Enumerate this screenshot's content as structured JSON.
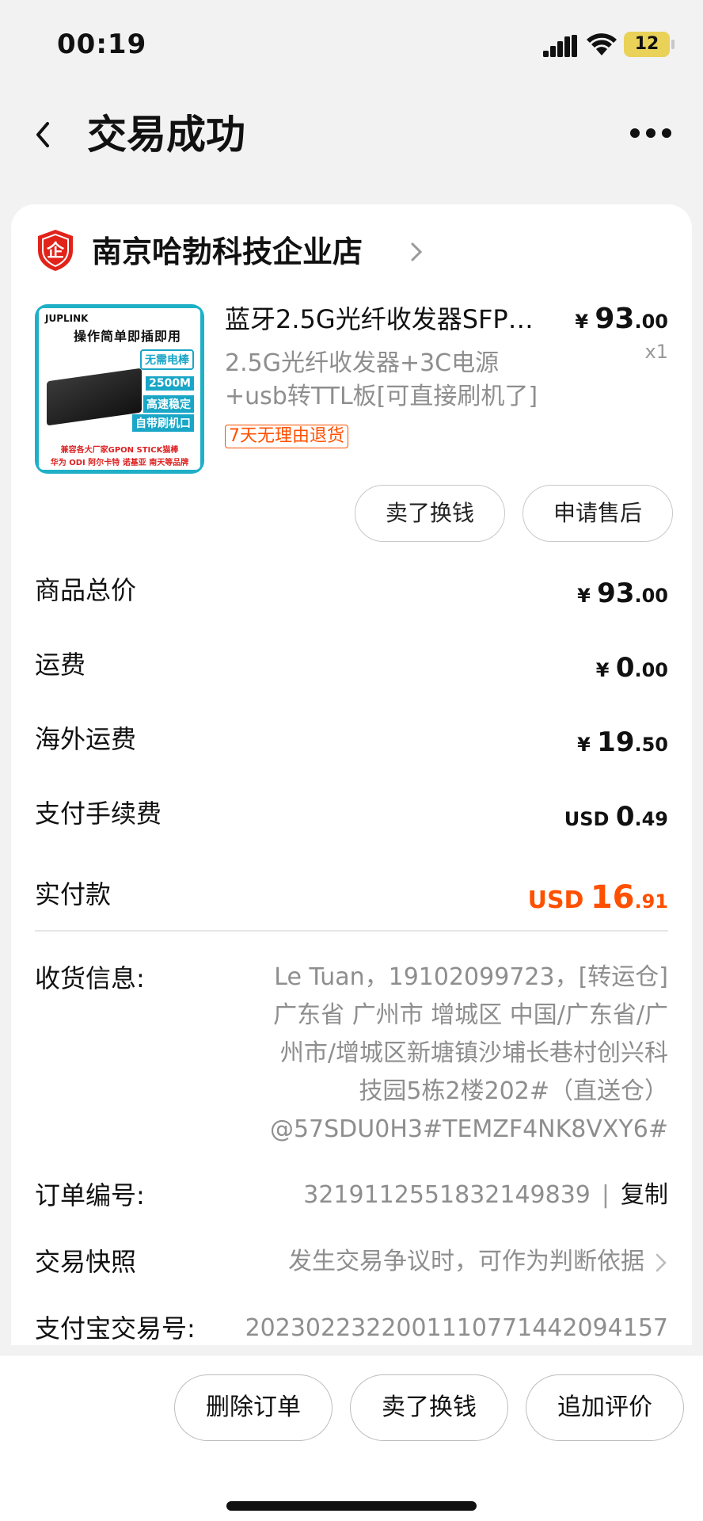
{
  "status_bar": {
    "time": "00:19",
    "battery": "12"
  },
  "nav": {
    "title": "交易成功"
  },
  "shop": {
    "name": "南京哈勃科技企业店"
  },
  "product": {
    "title": "蓝牙2.5G光纤收发器SFP…",
    "price_symbol": "¥",
    "price_int": "93",
    "price_dec": ".00",
    "quantity": "x1",
    "spec_line1": "2.5G光纤收发器+3C电源",
    "spec_line2": "+usb转TTL板[可直接刷机了]",
    "return_badge": "7天无理由退货",
    "image_text": {
      "brand": "JUPLINK",
      "headline": "操作简单即插即用",
      "tag1": "无需电棒",
      "tag2": "2500M",
      "tag3": "高速稳定",
      "tag4": "自带刷机口",
      "footer1": "兼容各大厂家GPON STICK猫棒",
      "footer2": "华为 ODI 阿尔卡特 诺基亚 南天等品牌"
    }
  },
  "actions": {
    "sell_label": "卖了换钱",
    "after_sale_label": "申请售后"
  },
  "fees": {
    "goods_total": {
      "label": "商品总价",
      "cur": "¥",
      "int": "93",
      "dec": ".00"
    },
    "shipping": {
      "label": "运费",
      "cur": "¥",
      "int": "0",
      "dec": ".00"
    },
    "overseas_shipping": {
      "label": "海外运费",
      "cur": "¥",
      "int": "19",
      "dec": ".50"
    },
    "payment_fee": {
      "label": "支付手续费",
      "cur": "USD",
      "int": "0",
      "dec": ".49"
    },
    "paid": {
      "label": "实付款",
      "cur": "USD",
      "int": "16",
      "dec": ".91"
    }
  },
  "address": {
    "label": "收货信息:",
    "lines": [
      "Le Tuan，19102099723，[转运仓]",
      "广东省 广州市 增城区 中国/广东省/广",
      "州市/增城区新塘镇沙埔长巷村创兴科",
      "技园5栋2楼202#（直送仓）",
      "@57SDU0H3#TEMZF4NK8VXY6#"
    ]
  },
  "order": {
    "label": "订单编号:",
    "number": "3219112551832149839",
    "sep": "|",
    "copy_label": "复制"
  },
  "snapshot": {
    "label": "交易快照",
    "value": "发生交易争议时，可作为判断依据"
  },
  "alipay": {
    "label": "支付宝交易号:",
    "value": "2023022322001110771442094157"
  },
  "bottom_bar": {
    "delete_label": "删除订单",
    "sell_label": "卖了换钱",
    "review_label": "追加评价"
  },
  "colors": {
    "accent": "#ff5000",
    "shop_badge": "#e2231a"
  }
}
